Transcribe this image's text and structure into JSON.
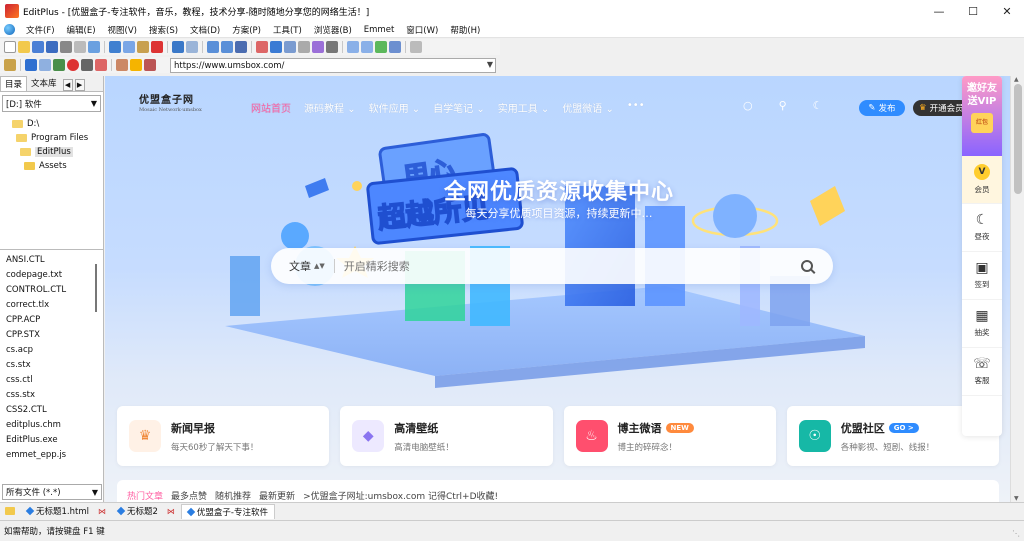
{
  "window": {
    "title": "EditPlus - [优盟盒子-专注软件，音乐，教程，技术分享-随时随地分享您的网络生活！]"
  },
  "menu": [
    "文件(F)",
    "编辑(E)",
    "视图(V)",
    "搜索(S)",
    "文档(D)",
    "方案(P)",
    "工具(T)",
    "浏览器(B)",
    "Emmet",
    "窗口(W)",
    "帮助(H)"
  ],
  "address_bar": {
    "url": "https://www.umsbox.com/"
  },
  "left_panel": {
    "tabs": [
      "目录",
      "文本库"
    ],
    "drive": "[D:] 软件",
    "tree": [
      {
        "label": "D:\\",
        "indent": 1
      },
      {
        "label": "Program Files",
        "indent": 2
      },
      {
        "label": "EditPlus",
        "indent": 3,
        "selected": true
      },
      {
        "label": "Assets",
        "indent": 3
      }
    ],
    "files": [
      "ANSI.CTL",
      "codepage.txt",
      "CONTROL.CTL",
      "correct.tlx",
      "CPP.ACP",
      "CPP.STX",
      "cs.acp",
      "cs.stx",
      "css.ctl",
      "css.stx",
      "CSS2.CTL",
      "editplus.chm",
      "EditPlus.exe",
      "emmet_epp.js"
    ],
    "filter": "所有文件 (*.*)"
  },
  "site": {
    "logo_text": "优盟盒子网",
    "logo_sub": "Mosaic Network·umsbox",
    "nav": [
      "网站首页",
      "源码教程",
      "软件应用",
      "自学笔记",
      "实用工具",
      "优盟微语",
      "•••"
    ],
    "nav_has_caret": [
      false,
      true,
      true,
      true,
      true,
      true,
      false
    ],
    "publish_label": "发布",
    "member_label": "开通会员",
    "hero_art_text": "用心 超越所见",
    "hero_title": "全网优质资源收集中心",
    "hero_subtitle": "每天分享优质项目资源，持续更新中…",
    "search": {
      "type": "文章",
      "placeholder": "开启精彩搜索"
    },
    "cards": [
      {
        "title": "新闻早报",
        "desc": "每天60秒了解天下事！",
        "icon": "crown-icon",
        "icon_bg": "#fff1e6",
        "icon_color": "#f08a3c",
        "badge": ""
      },
      {
        "title": "高清壁纸",
        "desc": "高清电脑壁纸！",
        "icon": "diamond-icon",
        "icon_bg": "#ede9ff",
        "icon_color": "#8a74f0",
        "badge": ""
      },
      {
        "title": "博主微语",
        "desc": "博主的碎碎念！",
        "icon": "flame-icon",
        "icon_bg": "#ff4f6e",
        "icon_color": "#ffffff",
        "badge": "NEW",
        "badge_color": "#ff8a3d"
      },
      {
        "title": "优盟社区",
        "desc": "各种影视、短剧、线报！",
        "icon": "planet-icon",
        "icon_bg": "#16b8a6",
        "icon_color": "#ffffff",
        "badge": "GO >",
        "badge_color": "#2f8cff"
      }
    ],
    "hot_tabs": [
      "热门文章",
      "最多点赞",
      "随机推荐",
      "最新更新"
    ],
    "hot_note": ">优盟盒子网址:umsbox.com 记得Ctrl+D收藏!",
    "float_bar": {
      "vip_text": [
        "邀好友",
        "送VIP"
      ],
      "vip_packet": "红包",
      "items": [
        {
          "label": "会员",
          "icon": "vip-icon"
        },
        {
          "label": "昼夜",
          "icon": "moon-icon"
        },
        {
          "label": "签到",
          "icon": "calendar-icon"
        },
        {
          "label": "抽奖",
          "icon": "gift-icon"
        },
        {
          "label": "客服",
          "icon": "headset-icon"
        }
      ]
    }
  },
  "doc_tabs": [
    {
      "label": "无标题1.html",
      "active": false
    },
    {
      "label": "无标题2",
      "active": false
    },
    {
      "label": "优盟盒子-专注软件",
      "active": true
    }
  ],
  "status": "如需帮助，请按键盘 F1 键",
  "colors": {
    "accent_pink": "#ff5fa2",
    "accent_blue": "#2f8cff",
    "hero_bg_top": "#b9d6ff"
  }
}
